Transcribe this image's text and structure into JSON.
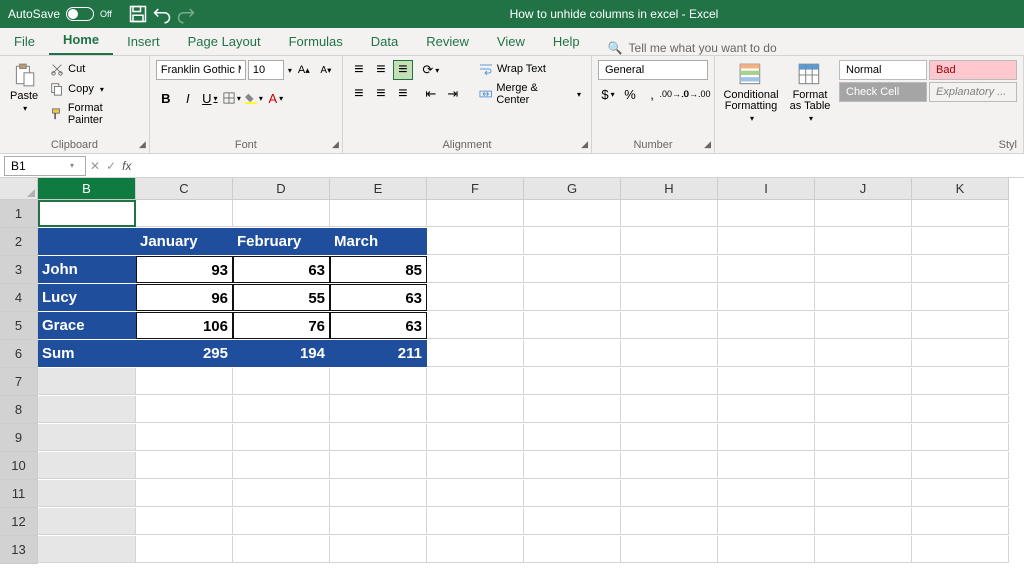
{
  "titlebar": {
    "autosave": "AutoSave",
    "autosave_state": "Off",
    "title": "How to unhide columns in excel  -  Excel"
  },
  "tabs": [
    "File",
    "Home",
    "Insert",
    "Page Layout",
    "Formulas",
    "Data",
    "Review",
    "View",
    "Help"
  ],
  "tellme": "Tell me what you want to do",
  "clipboard": {
    "paste": "Paste",
    "cut": "Cut",
    "copy": "Copy",
    "painter": "Format Painter",
    "label": "Clipboard"
  },
  "font": {
    "name": "Franklin Gothic M",
    "size": "10",
    "label": "Font"
  },
  "alignment": {
    "wrap": "Wrap Text",
    "merge": "Merge & Center",
    "label": "Alignment"
  },
  "number": {
    "format": "General",
    "label": "Number"
  },
  "styles_group": {
    "cond": "Conditional Formatting",
    "tbl": "Format as Table",
    "normal": "Normal",
    "bad": "Bad",
    "check": "Check Cell",
    "expl": "Explanatory ...",
    "label": "Styl"
  },
  "namebox": "B1",
  "fx": "fx",
  "columns": [
    "B",
    "C",
    "D",
    "E",
    "F",
    "G",
    "H",
    "I",
    "J",
    "K"
  ],
  "rows": [
    "1",
    "2",
    "3",
    "4",
    "5",
    "6",
    "7",
    "8",
    "9",
    "10",
    "11",
    "12",
    "13"
  ],
  "chart_data": {
    "type": "table",
    "title": "",
    "columns": [
      "",
      "January",
      "February",
      "March"
    ],
    "rows": [
      {
        "name": "John",
        "values": [
          93,
          63,
          85
        ]
      },
      {
        "name": "Lucy",
        "values": [
          96,
          55,
          63
        ]
      },
      {
        "name": "Grace",
        "values": [
          106,
          76,
          63
        ]
      },
      {
        "name": "Sum",
        "values": [
          295,
          194,
          211
        ]
      }
    ]
  }
}
